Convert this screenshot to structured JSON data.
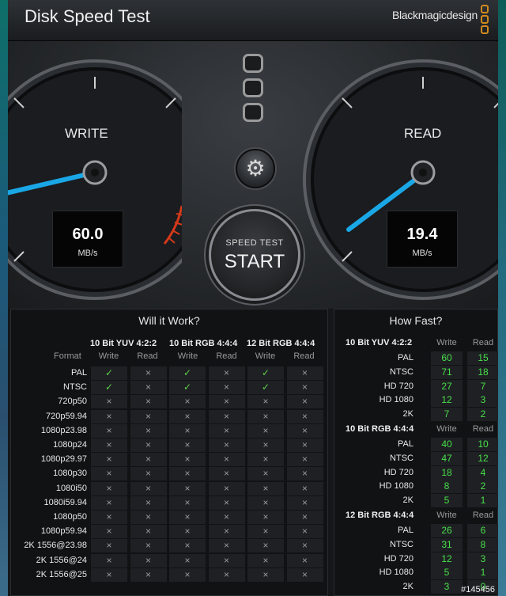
{
  "window": {
    "title": "Disk Speed Test",
    "brand": "Blackmagicdesign"
  },
  "write_gauge": {
    "label": "WRITE",
    "value": "60.0",
    "unit": "MB/s"
  },
  "read_gauge": {
    "label": "READ",
    "value": "19.4",
    "unit": "MB/s"
  },
  "start_button": {
    "small": "SPEED TEST",
    "big": "START"
  },
  "settings_icon": "gear-icon",
  "colors": {
    "needle": "#1aa7e6",
    "ok": "#5fd14a",
    "value_green": "#48e04a",
    "redline": "#d43a1a"
  },
  "will_it_work": {
    "title": "Will it Work?",
    "format_label": "Format",
    "groups": [
      "10 Bit YUV 4:2:2",
      "10 Bit RGB 4:4:4",
      "12 Bit RGB 4:4:4"
    ],
    "col_write": "Write",
    "col_read": "Read",
    "rows": [
      {
        "name": "PAL",
        "c": [
          "✓",
          "×",
          "✓",
          "×",
          "✓",
          "×"
        ]
      },
      {
        "name": "NTSC",
        "c": [
          "✓",
          "×",
          "✓",
          "×",
          "✓",
          "×"
        ]
      },
      {
        "name": "720p50",
        "c": [
          "×",
          "×",
          "×",
          "×",
          "×",
          "×"
        ]
      },
      {
        "name": "720p59.94",
        "c": [
          "×",
          "×",
          "×",
          "×",
          "×",
          "×"
        ]
      },
      {
        "name": "1080p23.98",
        "c": [
          "×",
          "×",
          "×",
          "×",
          "×",
          "×"
        ]
      },
      {
        "name": "1080p24",
        "c": [
          "×",
          "×",
          "×",
          "×",
          "×",
          "×"
        ]
      },
      {
        "name": "1080p29.97",
        "c": [
          "×",
          "×",
          "×",
          "×",
          "×",
          "×"
        ]
      },
      {
        "name": "1080p30",
        "c": [
          "×",
          "×",
          "×",
          "×",
          "×",
          "×"
        ]
      },
      {
        "name": "1080i50",
        "c": [
          "×",
          "×",
          "×",
          "×",
          "×",
          "×"
        ]
      },
      {
        "name": "1080i59.94",
        "c": [
          "×",
          "×",
          "×",
          "×",
          "×",
          "×"
        ]
      },
      {
        "name": "1080p50",
        "c": [
          "×",
          "×",
          "×",
          "×",
          "×",
          "×"
        ]
      },
      {
        "name": "1080p59.94",
        "c": [
          "×",
          "×",
          "×",
          "×",
          "×",
          "×"
        ]
      },
      {
        "name": "2K 1556@23.98",
        "c": [
          "×",
          "×",
          "×",
          "×",
          "×",
          "×"
        ]
      },
      {
        "name": "2K 1556@24",
        "c": [
          "×",
          "×",
          "×",
          "×",
          "×",
          "×"
        ]
      },
      {
        "name": "2K 1556@25",
        "c": [
          "×",
          "×",
          "×",
          "×",
          "×",
          "×"
        ]
      }
    ]
  },
  "how_fast": {
    "title": "How Fast?",
    "col_write": "Write",
    "col_read": "Read",
    "groups": [
      {
        "name": "10 Bit YUV 4:2:2",
        "rows": [
          {
            "name": "PAL",
            "w": "60",
            "r": "15"
          },
          {
            "name": "NTSC",
            "w": "71",
            "r": "18"
          },
          {
            "name": "HD 720",
            "w": "27",
            "r": "7"
          },
          {
            "name": "HD 1080",
            "w": "12",
            "r": "3"
          },
          {
            "name": "2K",
            "w": "7",
            "r": "2"
          }
        ]
      },
      {
        "name": "10 Bit RGB 4:4:4",
        "rows": [
          {
            "name": "PAL",
            "w": "40",
            "r": "10"
          },
          {
            "name": "NTSC",
            "w": "47",
            "r": "12"
          },
          {
            "name": "HD 720",
            "w": "18",
            "r": "4"
          },
          {
            "name": "HD 1080",
            "w": "8",
            "r": "2"
          },
          {
            "name": "2K",
            "w": "5",
            "r": "1"
          }
        ]
      },
      {
        "name": "12 Bit RGB 4:4:4",
        "rows": [
          {
            "name": "PAL",
            "w": "26",
            "r": "6"
          },
          {
            "name": "NTSC",
            "w": "31",
            "r": "8"
          },
          {
            "name": "HD 720",
            "w": "12",
            "r": "3"
          },
          {
            "name": "HD 1080",
            "w": "5",
            "r": "1"
          },
          {
            "name": "2K",
            "w": "3",
            "r": "0"
          }
        ]
      }
    ]
  },
  "watermark": "#145456"
}
